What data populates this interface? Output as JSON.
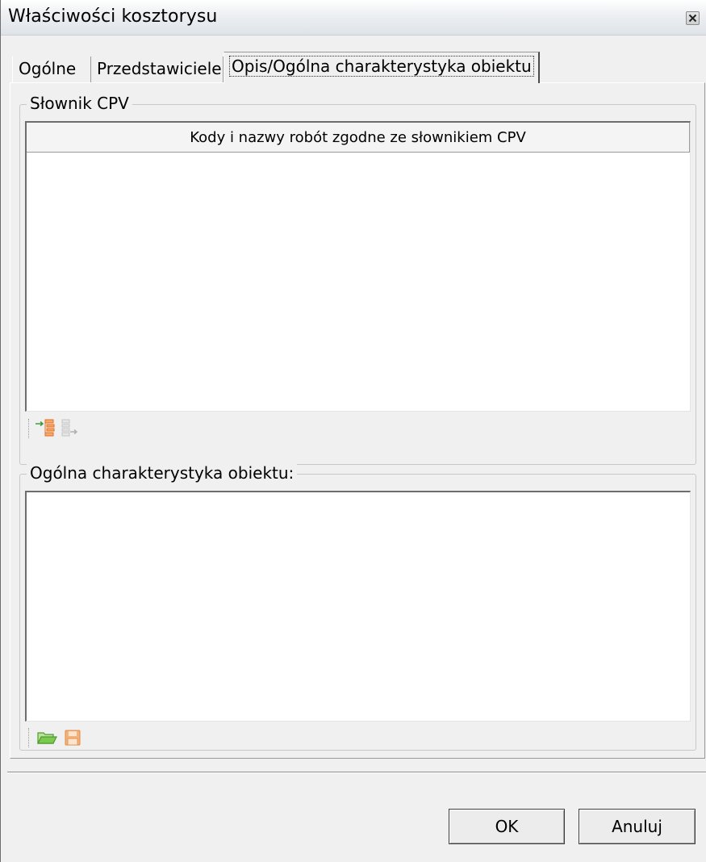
{
  "window": {
    "title": "Właściwości kosztorysu"
  },
  "tabs": [
    {
      "label": "Ogólne",
      "active": false
    },
    {
      "label": "Przedstawiciele",
      "active": false
    },
    {
      "label": "Opis/Ogólna charakterystyka obiektu",
      "active": true
    }
  ],
  "cpv_group": {
    "legend": "Słownik CPV",
    "column_header": "Kody i nazwy robót zgodne ze słownikiem CPV",
    "rows": [],
    "toolbar": [
      {
        "icon": "add-from-dictionary-icon",
        "enabled": true
      },
      {
        "icon": "remove-to-dictionary-icon",
        "enabled": false
      }
    ]
  },
  "description_group": {
    "legend": "Ogólna charakterystyka obiektu:",
    "text": "",
    "toolbar": [
      {
        "icon": "open-folder-icon",
        "enabled": true
      },
      {
        "icon": "save-icon",
        "enabled": false
      }
    ]
  },
  "buttons": {
    "ok": "OK",
    "cancel": "Anuluj"
  }
}
